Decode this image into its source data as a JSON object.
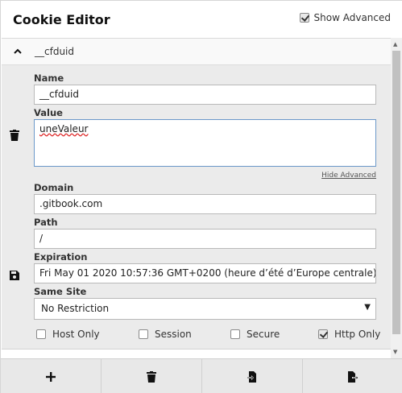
{
  "header": {
    "title": "Cookie Editor",
    "show_advanced_label": "Show Advanced",
    "show_advanced_checked": true
  },
  "cookie": {
    "name_header": "__cfduid",
    "name_label": "Name",
    "name_value": "__cfduid",
    "value_label": "Value",
    "value_value": "uneValeur",
    "hide_advanced": "Hide Advanced",
    "domain_label": "Domain",
    "domain_value": ".gitbook.com",
    "path_label": "Path",
    "path_value": "/",
    "expiration_label": "Expiration",
    "expiration_value": "Fri May 01 2020 10:57:36 GMT+0200 (heure d’été d’Europe centrale)",
    "samesite_label": "Same Site",
    "samesite_value": "No Restriction",
    "flags": {
      "host_only": {
        "label": "Host Only",
        "checked": false
      },
      "session": {
        "label": "Session",
        "checked": false
      },
      "secure": {
        "label": "Secure",
        "checked": false
      },
      "http_only": {
        "label": "Http Only",
        "checked": true
      }
    }
  },
  "icons": {
    "collapse": "chevron-up-icon",
    "delete_cookie": "trash-icon",
    "save_cookie": "save-icon",
    "add": "plus-icon",
    "delete_all": "trash-icon",
    "import": "import-icon",
    "export": "export-icon"
  }
}
